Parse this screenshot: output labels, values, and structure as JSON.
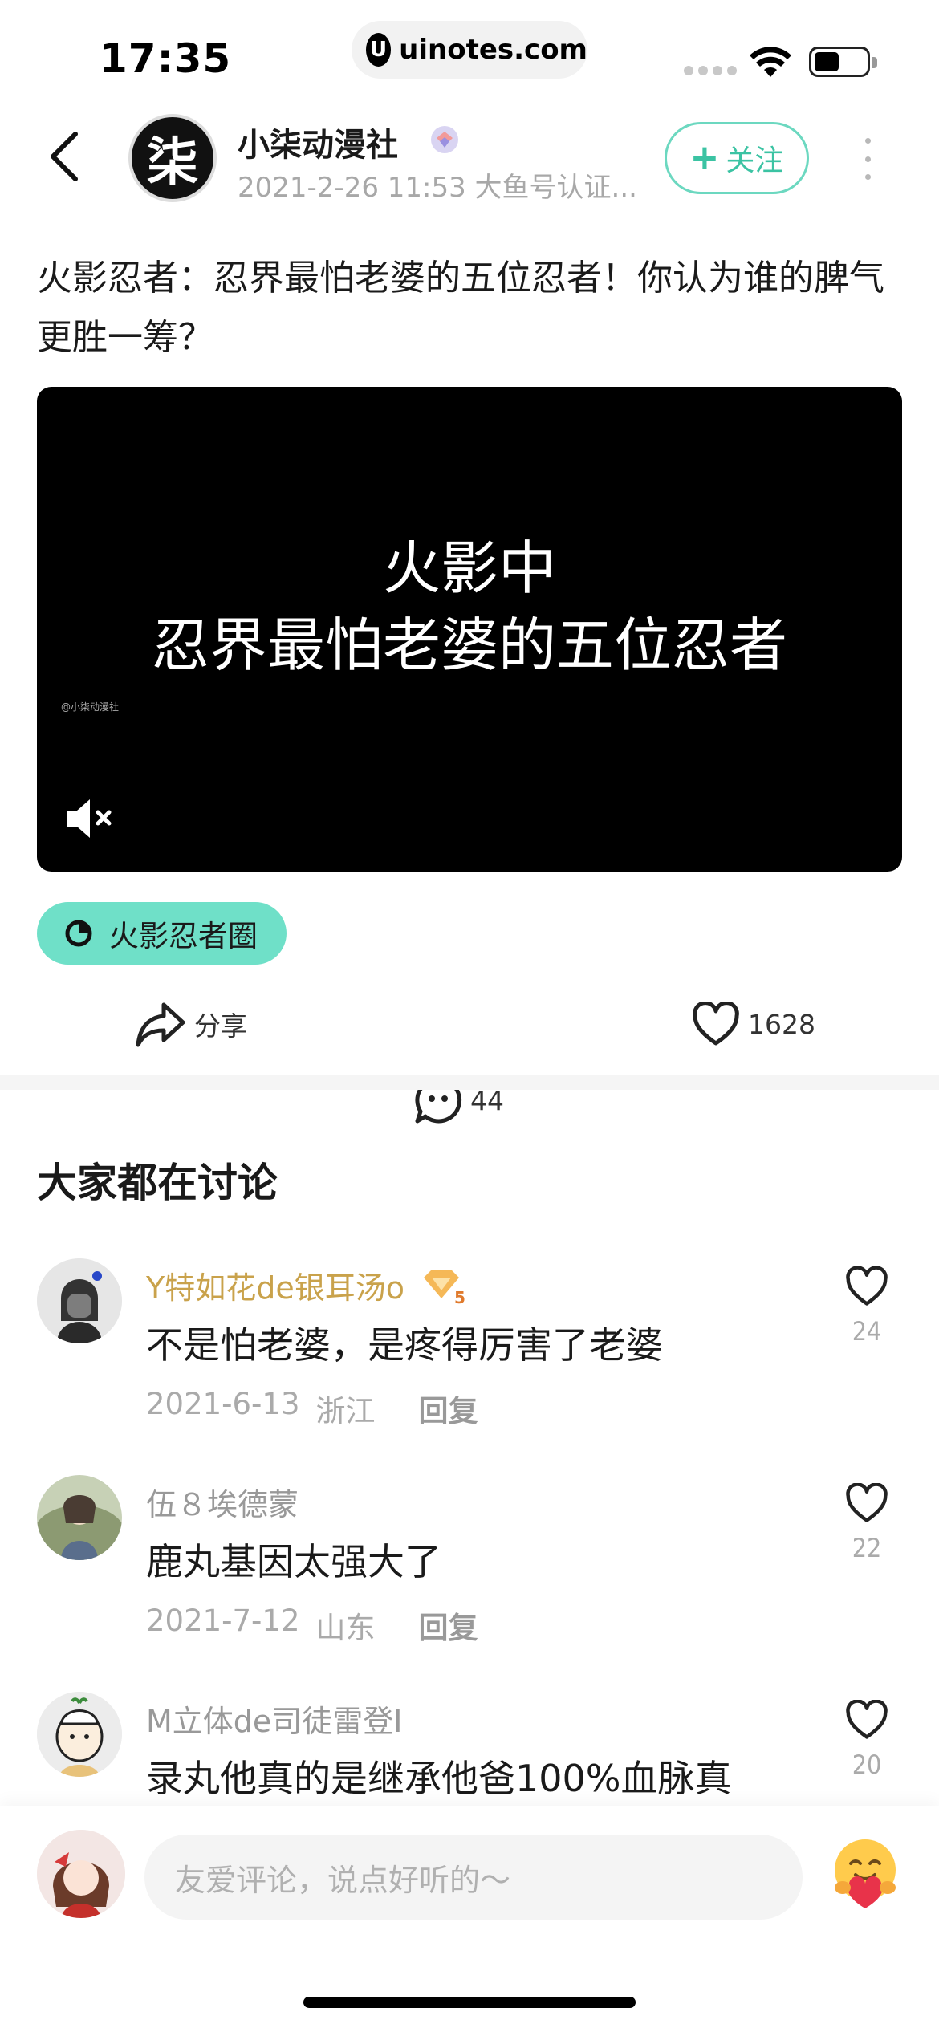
{
  "status_bar": {
    "time": "17:35",
    "url": "uinotes.com",
    "url_icon": "U"
  },
  "header": {
    "author_name": "小柒动漫社",
    "author_avatar_char": "柒",
    "author_meta": "2021-2-26 11:53 大鱼号认证...",
    "follow_plus": "+",
    "follow_label": "关注"
  },
  "post": {
    "title": "火影忍者：忍界最怕老婆的五位忍者！你认为谁的脾气更胜一筹？",
    "video_caption_line1": "火影中",
    "video_caption_line2": "忍界最怕老婆的五位忍者",
    "video_watermark": "@小柒动漫社",
    "tag": "火影忍者圈",
    "actions": {
      "share_label": "分享",
      "comment_count": "44",
      "like_count": "1628"
    }
  },
  "comments_section": {
    "title": "大家都在讨论",
    "items": [
      {
        "name": "Y特如花de银耳汤o",
        "badge_level": "5",
        "text": "不是怕老婆，是疼得厉害了老婆",
        "date": "2021-6-13",
        "location": "浙江",
        "reply_label": "回复",
        "likes": "24"
      },
      {
        "name": "伍８埃德蒙",
        "text": "鹿丸基因太强大了",
        "date": "2021-7-12",
        "location": "山东",
        "reply_label": "回复",
        "likes": "22"
      },
      {
        "name": "M立体de司徒雷登I",
        "text": "录丸他真的是继承他爸100%血脉真",
        "likes": "20"
      }
    ]
  },
  "bottom_bar": {
    "input_placeholder": "友爱评论，说点好听的～"
  },
  "colors": {
    "accent": "#6fe0c8",
    "follow_text": "#3bc3a3",
    "gold_name": "#c9a24b",
    "muted": "#aaaaaa"
  },
  "icons": [
    "back-chevron-icon",
    "verified-badge-icon",
    "more-icon",
    "mute-icon",
    "circle-tag-icon",
    "share-icon",
    "comment-icon",
    "heart-icon",
    "level-badge-icon",
    "emoji-icon"
  ]
}
